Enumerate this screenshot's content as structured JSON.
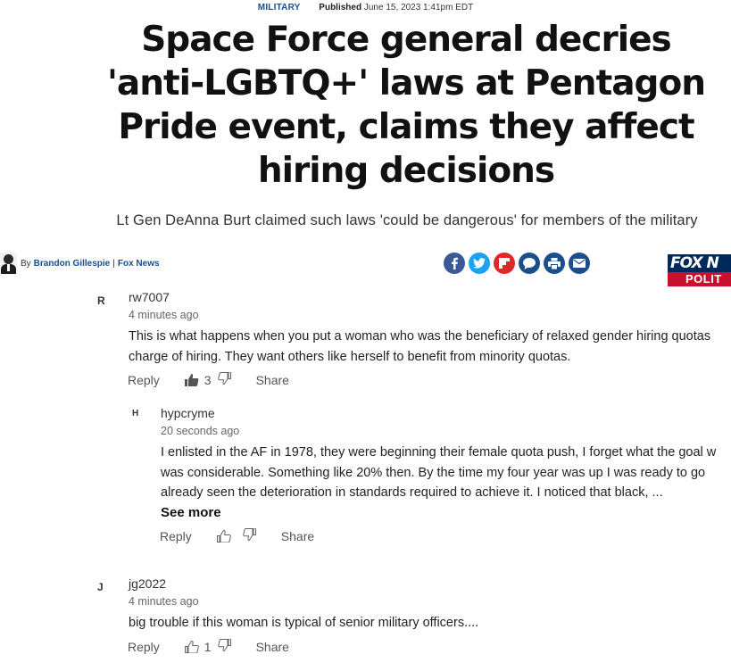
{
  "article": {
    "category": "MILITARY",
    "published_label": "Published",
    "published_date": "June 15, 2023 1:41pm EDT",
    "headline": "Space Force general decries 'anti-LGBTQ+' laws at Pentagon Pride event, claims they affect hiring decisions",
    "subheadline": "Lt Gen DeAnna Burt claimed such laws 'could be dangerous' for members of the military",
    "byline": {
      "by": "By",
      "author": "Brandon Gillespie",
      "separator": "|",
      "outlet": "Fox News"
    },
    "share_icons": [
      "facebook-icon",
      "twitter-icon",
      "flipboard-icon",
      "comment-icon",
      "print-icon",
      "email-icon"
    ],
    "logo": {
      "top": "FOX N",
      "bottom": "POLIT"
    }
  },
  "comments": [
    {
      "initial": "R",
      "username": "rw7007",
      "time": "4 minutes ago",
      "lines": [
        "This is what happens when you put a woman who was the beneficiary of relaxed gender hiring quotas",
        "charge of hiring. They want others like herself to benefit from minority quotas."
      ],
      "reply_label": "Reply",
      "likes": "3",
      "share_label": "Share"
    },
    {
      "initial": "H",
      "username": "hypcryme",
      "time": "20 seconds ago",
      "lines": [
        "I enlisted in the AF in 1978, they were beginning their female quota push, I forget what the goal w",
        "was considerable.  Something like 20% then.  By the time my four year was up I was ready to go",
        "already seen the deterioration in standards required to achieve it.  I noticed that black, ..."
      ],
      "see_more": "See more",
      "reply_label": "Reply",
      "likes": "",
      "share_label": "Share"
    },
    {
      "initial": "J",
      "username": "jg2022",
      "time": "4 minutes ago",
      "lines": [
        "big trouble if this woman is typical of senior military officers...."
      ],
      "reply_label": "Reply",
      "likes": "1",
      "share_label": "Share"
    }
  ],
  "colors": {
    "link_blue": "#1a4f8b",
    "facebook": "#3b5998",
    "twitter": "#1da1f2",
    "flipboard": "#e12828",
    "fox_navy": "#00295a",
    "fox_red": "#c8102e"
  }
}
